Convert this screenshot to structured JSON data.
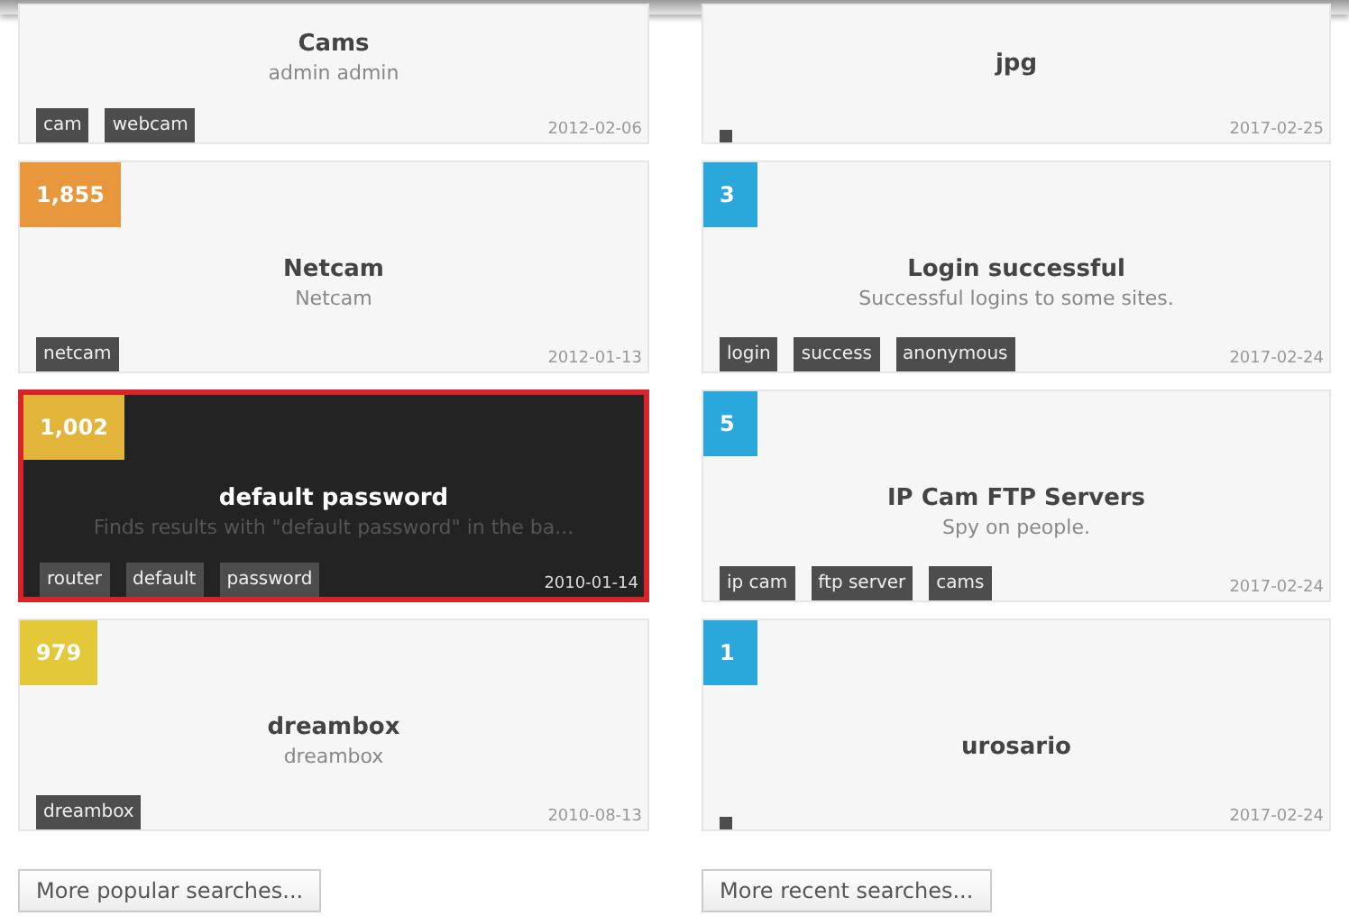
{
  "columns": [
    {
      "cards": [
        {
          "title": "Cams",
          "description": "admin admin",
          "tags": [
            "cam",
            "webcam"
          ],
          "date": "2012-02-06",
          "selected": false
        },
        {
          "count": "1,855",
          "color": "#e8973c",
          "title": "Netcam",
          "description": "Netcam",
          "tags": [
            "netcam"
          ],
          "date": "2012-01-13",
          "selected": false
        },
        {
          "count": "1,002",
          "color": "#e3b43a",
          "title": "default password",
          "description": "Finds results with \"default password\" in the ba...",
          "tags": [
            "router",
            "default",
            "password"
          ],
          "date": "2010-01-14",
          "selected": true
        },
        {
          "count": "979",
          "color": "#e3c93a",
          "title": "dreambox",
          "description": "dreambox",
          "tags": [
            "dreambox"
          ],
          "date": "2010-08-13",
          "selected": false
        }
      ],
      "more_button": "More popular searches..."
    },
    {
      "cards": [
        {
          "title": "jpg",
          "blank_tag": true,
          "date": "2017-02-25",
          "selected": false
        },
        {
          "count": "3",
          "color": "#2aa8db",
          "title": "Login successful",
          "description": "Successful logins to some sites.",
          "tags": [
            "login",
            "success",
            "anonymous"
          ],
          "date": "2017-02-24",
          "selected": false
        },
        {
          "count": "5",
          "color": "#2aa8db",
          "title": "IP Cam FTP Servers",
          "description": "Spy on people.",
          "tags": [
            "ip cam",
            "ftp server",
            "cams"
          ],
          "date": "2017-02-24",
          "selected": false
        },
        {
          "count": "1",
          "color": "#2aa8db",
          "title": "urosario",
          "blank_tag": true,
          "date": "2017-02-24",
          "selected": false
        }
      ],
      "more_button": "More recent searches..."
    }
  ]
}
